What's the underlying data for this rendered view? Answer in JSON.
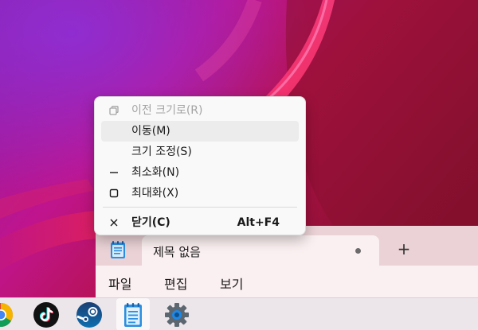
{
  "notepad": {
    "tab_title": "제목 없음",
    "new_tab_symbol": "+",
    "menus": [
      "파일",
      "편집",
      "보기"
    ]
  },
  "system_menu": {
    "items": [
      {
        "label": "이전 크기로(R)",
        "icon": "restore-icon",
        "enabled": false
      },
      {
        "label": "이동(M)",
        "icon": "",
        "enabled": true,
        "highlighted": true
      },
      {
        "label": "크기 조정(S)",
        "icon": "",
        "enabled": true
      },
      {
        "label": "최소화(N)",
        "icon": "minimize-icon",
        "enabled": true
      },
      {
        "label": "최대화(X)",
        "icon": "maximize-icon",
        "enabled": true
      },
      {
        "label": "닫기(C)",
        "icon": "close-icon",
        "enabled": true,
        "shortcut": "Alt+F4"
      }
    ]
  },
  "taskbar": {
    "apps": [
      "chrome-icon",
      "tiktok-icon",
      "steam-icon",
      "notepad-icon",
      "settings-icon"
    ],
    "active_app": "notepad-icon"
  },
  "colors": {
    "wallpaper_magenta": "#b0178a",
    "wallpaper_red": "#b3143e",
    "accent_blue": "#1e88e5"
  }
}
